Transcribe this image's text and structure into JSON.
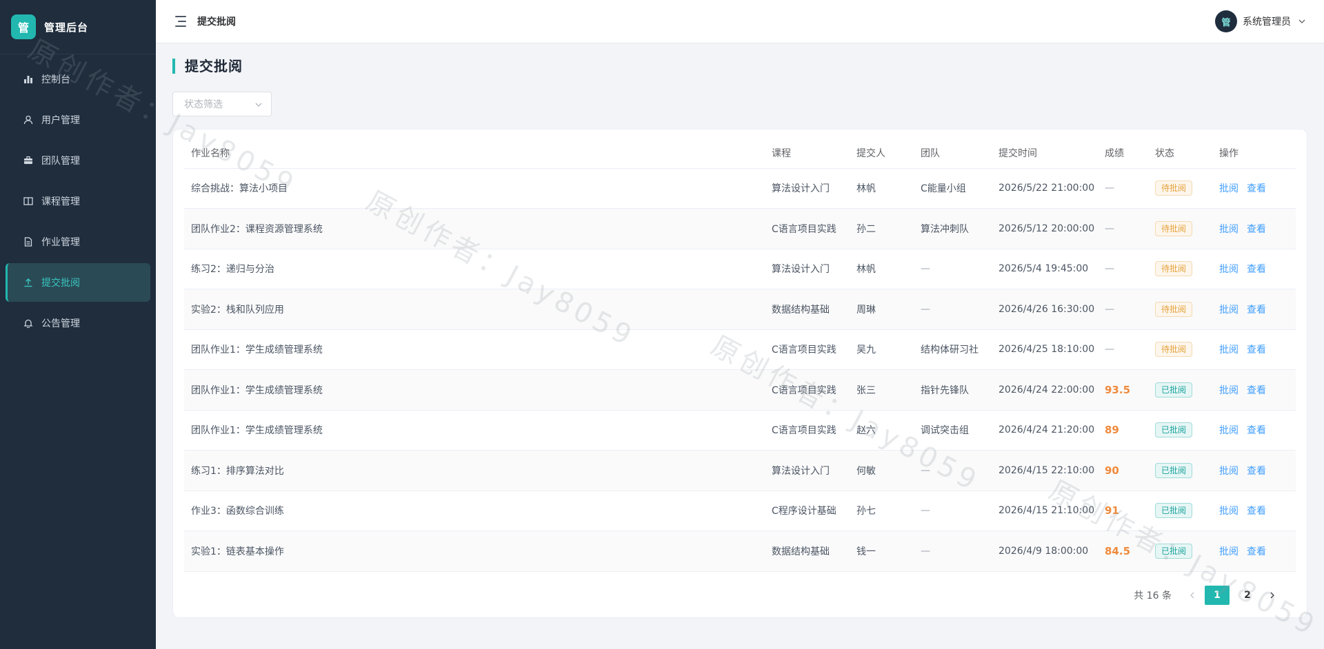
{
  "brand": {
    "logo_char": "管",
    "title": "管理后台"
  },
  "sidebar": {
    "items": [
      {
        "label": "控制台",
        "icon": "bar-chart-icon",
        "active": false
      },
      {
        "label": "用户管理",
        "icon": "user-icon",
        "active": false
      },
      {
        "label": "团队管理",
        "icon": "briefcase-icon",
        "active": false
      },
      {
        "label": "课程管理",
        "icon": "book-icon",
        "active": false
      },
      {
        "label": "作业管理",
        "icon": "document-icon",
        "active": false
      },
      {
        "label": "提交批阅",
        "icon": "upload-icon",
        "active": true
      },
      {
        "label": "公告管理",
        "icon": "bell-icon",
        "active": false
      }
    ]
  },
  "header": {
    "title": "提交批阅",
    "user": {
      "avatar_char": "管",
      "name": "系统管理员"
    }
  },
  "main": {
    "page_title": "提交批阅",
    "filter": {
      "placeholder": "状态筛选"
    }
  },
  "table": {
    "columns": [
      "作业名称",
      "课程",
      "提交人",
      "团队",
      "提交时间",
      "成绩",
      "状态",
      "操作"
    ],
    "rows": [
      {
        "name": "综合挑战：算法小项目",
        "course": "算法设计入门",
        "submitter": "林帆",
        "team": "C能量小组",
        "time": "2026/5/22 21:00:00",
        "score": "—",
        "status": "待批阅",
        "status_type": "pending"
      },
      {
        "name": "团队作业2：课程资源管理系统",
        "course": "C语言项目实践",
        "submitter": "孙二",
        "team": "算法冲刺队",
        "time": "2026/5/12 20:00:00",
        "score": "—",
        "status": "待批阅",
        "status_type": "pending"
      },
      {
        "name": "练习2：递归与分治",
        "course": "算法设计入门",
        "submitter": "林帆",
        "team": "—",
        "time": "2026/5/4 19:45:00",
        "score": "—",
        "status": "待批阅",
        "status_type": "pending"
      },
      {
        "name": "实验2：栈和队列应用",
        "course": "数据结构基础",
        "submitter": "周琳",
        "team": "—",
        "time": "2026/4/26 16:30:00",
        "score": "—",
        "status": "待批阅",
        "status_type": "pending"
      },
      {
        "name": "团队作业1：学生成绩管理系统",
        "course": "C语言项目实践",
        "submitter": "吴九",
        "team": "结构体研习社",
        "time": "2026/4/25 18:10:00",
        "score": "—",
        "status": "待批阅",
        "status_type": "pending"
      },
      {
        "name": "团队作业1：学生成绩管理系统",
        "course": "C语言项目实践",
        "submitter": "张三",
        "team": "指针先锋队",
        "time": "2026/4/24 22:00:00",
        "score": "93.5",
        "status": "已批阅",
        "status_type": "done"
      },
      {
        "name": "团队作业1：学生成绩管理系统",
        "course": "C语言项目实践",
        "submitter": "赵六",
        "team": "调试突击组",
        "time": "2026/4/24 21:20:00",
        "score": "89",
        "status": "已批阅",
        "status_type": "done"
      },
      {
        "name": "练习1：排序算法对比",
        "course": "算法设计入门",
        "submitter": "何敏",
        "team": "—",
        "time": "2026/4/15 22:10:00",
        "score": "90",
        "status": "已批阅",
        "status_type": "done"
      },
      {
        "name": "作业3：函数综合训练",
        "course": "C程序设计基础",
        "submitter": "孙七",
        "team": "—",
        "time": "2026/4/15 21:10:00",
        "score": "91",
        "status": "已批阅",
        "status_type": "done"
      },
      {
        "name": "实验1：链表基本操作",
        "course": "数据结构基础",
        "submitter": "钱一",
        "team": "—",
        "time": "2026/4/9 18:00:00",
        "score": "84.5",
        "status": "已批阅",
        "status_type": "done"
      }
    ],
    "actions": {
      "review": "批阅",
      "view": "查看"
    }
  },
  "pagination": {
    "total_text": "共 16 条",
    "pages": [
      "1",
      "2"
    ],
    "current": "1"
  },
  "watermark": "原创作者：Jay8059",
  "colors": {
    "accent": "#22b8b0",
    "sidebar_bg": "#1f2d3d",
    "link": "#409eff",
    "score": "#f08a3c",
    "pending": "#e6a23c"
  }
}
